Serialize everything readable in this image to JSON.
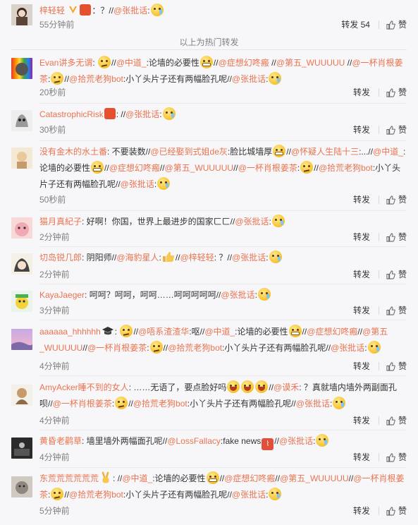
{
  "top_comment": {
    "user": "梓轻轻",
    "text_sep": "：？//",
    "mention": "@张批话",
    "colon": ":",
    "time": "55分钟前",
    "repost_label": "转发 54",
    "like_label": "赞"
  },
  "hot_divider": "以上为热门转发",
  "labels": {
    "repost": "转发",
    "like": "赞"
  },
  "comments": [
    {
      "user": "Evan讲多无谓",
      "parts": [
        ": ",
        "//",
        "@中道_",
        ":论墙的必要性",
        "//",
        "@症想幻咚瘢",
        " //",
        "@第五_WUUUUU",
        " //",
        "@一杯肖根姜茶",
        ":",
        "//",
        "@拾荒老狗bot",
        ":小丫头片子还有两幅脸孔呢//",
        "@张批话",
        ":"
      ],
      "time": "20秒前"
    },
    {
      "user": "CatastrophicRisk",
      "parts": [
        ": //",
        "@张批话",
        ":"
      ],
      "time": "30秒前"
    },
    {
      "user": "没有金木的水土番",
      "parts": [
        ": 不要装数//",
        "@已经娶到式姐de灰",
        ":脸比城墙厚",
        "//",
        "@怀疑人生陆十三",
        ":...//",
        "@中道_",
        ":论墙的必要性",
        "//",
        "@症想幻咚瘢",
        "//",
        "@第五_WUUUUU",
        "//",
        "@一杯肖根姜茶",
        ":",
        "//",
        "@拾荒老狗bot",
        ":小丫头片子还有两幅脸孔呢//",
        "@张批话",
        ":"
      ],
      "time": "50秒前"
    },
    {
      "user": "猫月真紀子",
      "parts": [
        ": 好啊！你国，世界上最进步的国家ㄈㄈ//",
        "@张批话",
        ":"
      ],
      "time": "2分钟前"
    },
    {
      "user": "切岛锐几郎",
      "parts": [
        ": 阴阳师//",
        "@海豹星人",
        ":",
        "//",
        "@梓轻轻",
        ": ？//",
        "@张批话",
        ":"
      ],
      "time": "2分钟前"
    },
    {
      "user": "KayaJaeger",
      "parts": [
        ": 呵呵？呵呵，呵呵……呵呵呵呵呵//",
        "@张批话",
        ":"
      ],
      "time": "3分钟前"
    },
    {
      "user": "aaaaaa_hhhhhh",
      "parts": [
        ": ",
        "//",
        "@唔系渣渣华",
        ":呕//",
        "@中道_",
        ":论墙的必要性",
        "//",
        "@症想幻咚瘢",
        "//",
        "@第五_WUUUUU",
        "//",
        "@一杯肖根姜茶",
        ":",
        "//",
        "@拾荒老狗bot",
        ":小丫头片子还有两幅脸孔呢//",
        "@张批话",
        ":"
      ],
      "time": "4分钟前"
    },
    {
      "user": "AmyAcker睡不到的女人",
      "parts": [
        ": ……无语了，要点脸好吗",
        "//",
        "@谟禾",
        ": ？真就墙内墙外两副面孔呗//",
        "@一杯肖根姜茶",
        ":",
        "//",
        "@拾荒老狗bot",
        ":小丫头片子还有两幅脸孔呢//",
        "@张批话",
        ":"
      ],
      "time": "4分钟前"
    },
    {
      "user": "黄昏老鹳草",
      "parts": [
        ": 墙里墙外两幅面孔呢//",
        "@LossFallacy",
        ":fake news",
        "//",
        "@张批话",
        ":"
      ],
      "time": "4分钟前"
    },
    {
      "user": "东荒荒荒荒荒荒",
      "parts": [
        ": ",
        "//",
        "@中道_",
        ":论墙的必要性",
        "//",
        "@症想幻咚瘢",
        "//",
        "@第五_WUUUUU",
        "//",
        "@一杯肖根姜茶",
        ":",
        "//",
        "@拾荒老狗bot",
        ":小丫头片子还有两幅脸孔呢//",
        "@张批话",
        ":"
      ],
      "time": "5分钟前"
    }
  ],
  "icons": {
    "like": "thumbs-up-icon",
    "verified": "verified-v-icon",
    "emoji": "emoji-face-icon"
  },
  "colors": {
    "accent": "#eb7350",
    "muted": "#808080",
    "text": "#333333"
  }
}
